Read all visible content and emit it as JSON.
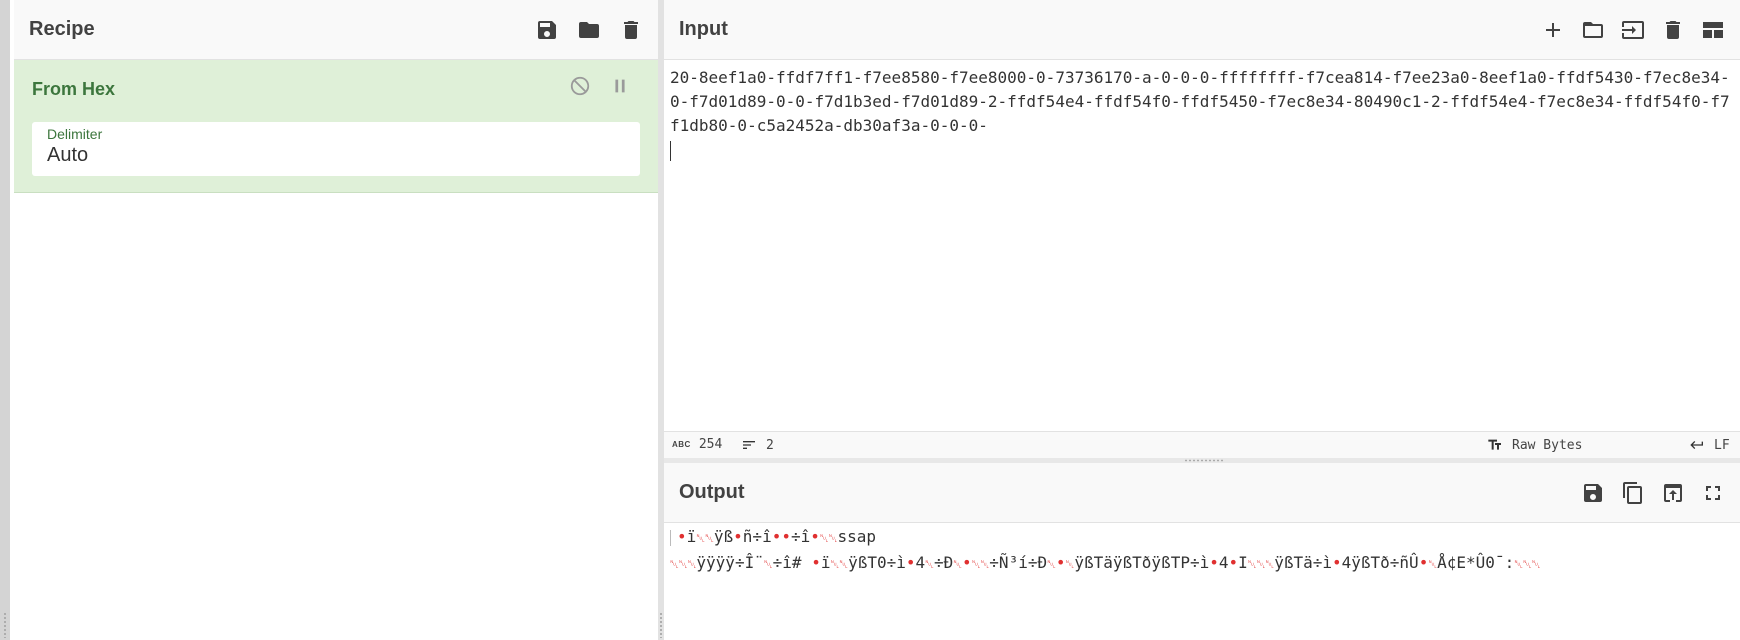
{
  "recipe": {
    "title": "Recipe",
    "icons": [
      "save-icon",
      "folder-icon",
      "trash-icon"
    ],
    "operations": [
      {
        "name": "From Hex",
        "controls": [
          "disable-icon",
          "pause-icon"
        ],
        "args": [
          {
            "label": "Delimiter",
            "value": "Auto"
          }
        ]
      }
    ]
  },
  "input": {
    "title": "Input",
    "icons": [
      "plus-icon",
      "folder-icon",
      "input-file-icon",
      "trash-icon",
      "layout-icon"
    ],
    "text": "20-8eef1a0-ffdf7ff1-f7ee8580-f7ee8000-0-73736170-a-0-0-0-ffffffff-f7cea814-f7ee23a0-8eef1a0-ffdf5430-f7ec8e34-0-f7d01d89-0-0-f7d1b3ed-f7d01d89-2-ffdf54e4-ffdf54f0-ffdf5450-f7ec8e34-80490c1-2-ffdf54e4-f7ec8e34-ffdf54f0-f7f1db80-0-c5a2452a-db30af3a-0-0-0-",
    "status": {
      "length_label": "ABC",
      "length": "254",
      "lines": "2",
      "format": "Raw Bytes",
      "eol": "LF"
    }
  },
  "output": {
    "title": "Output",
    "icons": [
      "save-icon",
      "copy-icon",
      "replace-input-icon",
      "maximize-icon"
    ],
    "line1": [
      {
        "t": "•",
        "k": "dot"
      },
      {
        "t": "ï",
        "k": "t"
      },
      {
        "t": "␀␀",
        "k": "ctl"
      },
      {
        "t": "ÿß",
        "k": "t"
      },
      {
        "t": "•",
        "k": "dot"
      },
      {
        "t": "ñ÷î",
        "k": "t"
      },
      {
        "t": "••",
        "k": "dot"
      },
      {
        "t": "÷î",
        "k": "t"
      },
      {
        "t": "•",
        "k": "dot"
      },
      {
        "t": "␀␀",
        "k": "ctl"
      },
      {
        "t": "ssap",
        "k": "t"
      }
    ],
    "line2": [
      {
        "t": "␀␀␀",
        "k": "ctl"
      },
      {
        "t": "ÿÿÿÿ÷Î¨",
        "k": "t"
      },
      {
        "t": "␀",
        "k": "ctl"
      },
      {
        "t": "÷î# ",
        "k": "t"
      },
      {
        "t": "•",
        "k": "dot"
      },
      {
        "t": "ï",
        "k": "t"
      },
      {
        "t": "␀␀",
        "k": "ctl"
      },
      {
        "t": "ÿßT0÷ì",
        "k": "t"
      },
      {
        "t": "•",
        "k": "dot"
      },
      {
        "t": "4",
        "k": "t"
      },
      {
        "t": "␀",
        "k": "ctl"
      },
      {
        "t": "÷Ð",
        "k": "t"
      },
      {
        "t": "␀",
        "k": "ctl"
      },
      {
        "t": "•",
        "k": "dot"
      },
      {
        "t": "␀␀",
        "k": "ctl"
      },
      {
        "t": "÷Ñ³í÷Ð",
        "k": "t"
      },
      {
        "t": "␀",
        "k": "ctl"
      },
      {
        "t": "•",
        "k": "dot"
      },
      {
        "t": "␀",
        "k": "ctl"
      },
      {
        "t": "ÿßTäÿßTðÿßTP÷ì",
        "k": "t"
      },
      {
        "t": "•",
        "k": "dot"
      },
      {
        "t": "4",
        "k": "t"
      },
      {
        "t": "•",
        "k": "dot"
      },
      {
        "t": "I",
        "k": "t"
      },
      {
        "t": "␀␀␀",
        "k": "ctl"
      },
      {
        "t": "ÿßTä÷ì",
        "k": "t"
      },
      {
        "t": "•",
        "k": "dot"
      },
      {
        "t": "4ÿßTð÷ñÛ",
        "k": "t"
      },
      {
        "t": "•",
        "k": "dot"
      },
      {
        "t": "␀",
        "k": "ctl"
      },
      {
        "t": "Å¢E*Û0¯:",
        "k": "t"
      },
      {
        "t": "␀␀␀",
        "k": "ctl"
      }
    ]
  }
}
